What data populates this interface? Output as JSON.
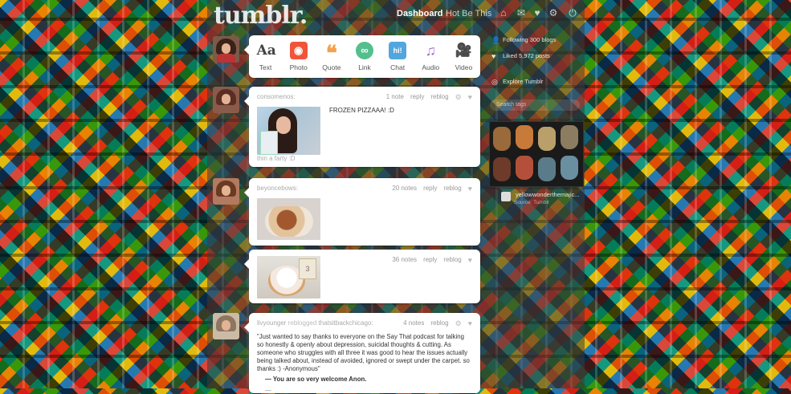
{
  "header": {
    "logo": "tumblr.",
    "nav_dashboard": "Dashboard",
    "nav_second": "Hot Be This",
    "icons": [
      "home-icon",
      "mail-icon",
      "heart-icon",
      "gear-icon",
      "power-icon"
    ]
  },
  "composer": {
    "buttons": [
      {
        "label": "Text",
        "glyph": "Aa"
      },
      {
        "label": "Photo",
        "glyph": "◉"
      },
      {
        "label": "Quote",
        "glyph": "❝"
      },
      {
        "label": "Link",
        "glyph": "∞"
      },
      {
        "label": "Chat",
        "glyph": "hi!"
      },
      {
        "label": "Audio",
        "glyph": "♫"
      },
      {
        "label": "Video",
        "glyph": "🎥"
      }
    ]
  },
  "posts": [
    {
      "user": "consomenos:",
      "notes": "1 note",
      "reply": "reply",
      "reblog": "reblog",
      "text": "FROZEN PIZZAAA! :D",
      "caption": "thin a farty :D"
    },
    {
      "user": "beyoncebows:",
      "notes": "20 notes",
      "reply": "reply",
      "reblog": "reblog"
    },
    {
      "notes": "36 notes",
      "reply": "reply",
      "reblog": "reblog",
      "can_label": "3"
    },
    {
      "user": "livyounger",
      "reblogged": "reblogged",
      "source": "thatsitbackchicago:",
      "notes": "4 notes",
      "reblog": "reblog",
      "body": "\"Just wanted to say thanks to everyone on the Say That podcast for talking so honestly & openly about depression, suicidal thoughts & cutting. As someone who struggles with all three it was good to hear the issues actually being talked about, instead of avoided, ignored or swept under the carpet. so thanks :) -Anonymous\"",
      "answer": "—  You are so very welcome Anon."
    }
  ],
  "sidebar": {
    "following": "Following 300 blogs",
    "liked": "Liked 5,972 posts",
    "explore": "Explore Tumblr",
    "search_placeholder": "Search tags",
    "radar_user": "yellowwonderthemajic...",
    "radar_sub": "Source: Tumblr"
  },
  "colors": {
    "accent": "#2c4762",
    "card": "#ffffff",
    "meta": "#999999"
  }
}
